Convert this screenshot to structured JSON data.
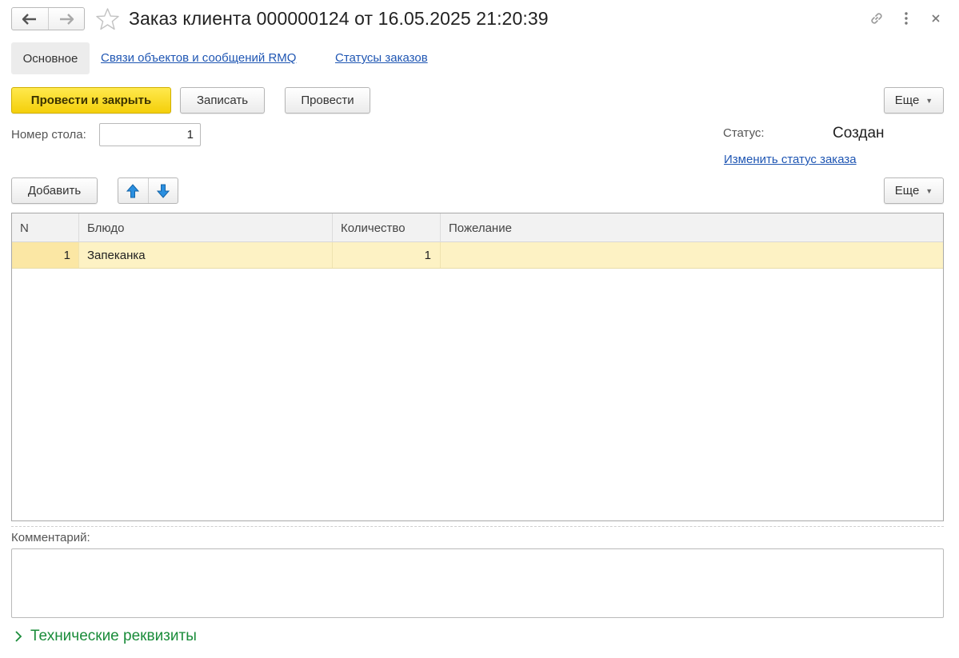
{
  "window": {
    "title": "Заказ клиента 000000124 от 16.05.2025 21:20:39"
  },
  "tabs": [
    {
      "label": "Основное",
      "active": true
    },
    {
      "label": "Связи объектов и сообщений RMQ",
      "active": false
    },
    {
      "label": "Статусы заказов",
      "active": false
    }
  ],
  "toolbar": {
    "post_close_label": "Провести и закрыть",
    "save_label": "Записать",
    "post_label": "Провести",
    "more_label": "Еще"
  },
  "fields": {
    "table_number_label": "Номер стола:",
    "table_number_value": "1",
    "status_label": "Статус:",
    "status_value": "Создан",
    "change_status_link": "Изменить статус заказа"
  },
  "table_toolbar": {
    "add_label": "Добавить",
    "more_label": "Еще"
  },
  "table": {
    "columns": [
      "N",
      "Блюдо",
      "Количество",
      "Пожелание"
    ],
    "rows": [
      {
        "n": "1",
        "dish": "Запеканка",
        "quantity": "1",
        "wish": ""
      }
    ]
  },
  "comment": {
    "label": "Комментарий:",
    "value": ""
  },
  "tech_group": {
    "label": "Технические реквизиты"
  },
  "colors": {
    "primary_button": "#f4cf0a",
    "link": "#1f56b3",
    "selected_row": "#fdf2c4",
    "group_green": "#1a8c3a"
  }
}
